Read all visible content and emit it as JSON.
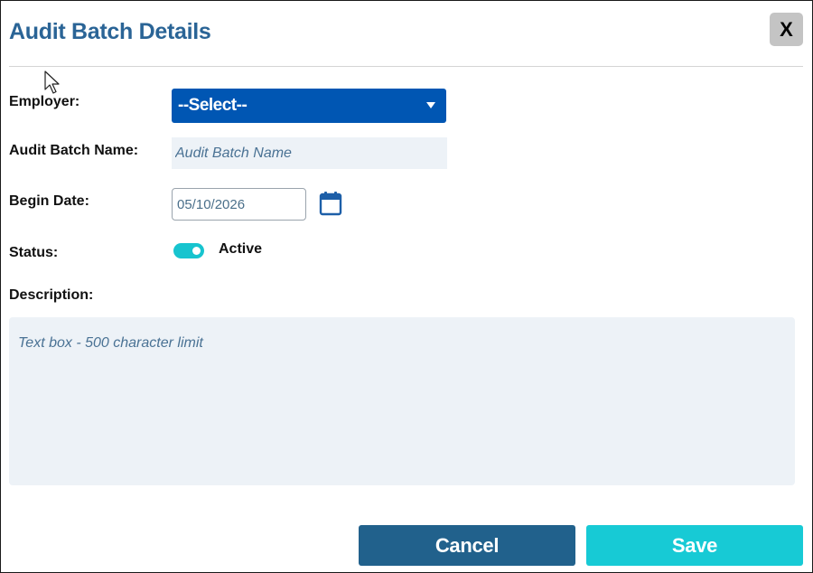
{
  "dialog": {
    "title": "Audit Batch Details",
    "close_label": "X"
  },
  "form": {
    "employer": {
      "label": "Employer:",
      "selected": "--Select--"
    },
    "batch_name": {
      "label": "Audit Batch Name:",
      "placeholder": "Audit Batch Name",
      "value": ""
    },
    "begin_date": {
      "label": "Begin Date:",
      "value": "05/10/2026"
    },
    "status": {
      "label": "Status:",
      "toggle_label": "Active",
      "on": true
    },
    "description": {
      "label": "Description:",
      "placeholder": "Text box - 500 character limit",
      "value": ""
    }
  },
  "buttons": {
    "cancel": "Cancel",
    "save": "Save"
  },
  "colors": {
    "title": "#2a6496",
    "select_bg": "#0056b3",
    "input_bg": "#edf2f7",
    "toggle_on": "#17c4cf",
    "cancel_bg": "#21618c",
    "save_bg": "#17cad5",
    "close_bg": "#c4c4c4"
  },
  "icons": {
    "calendar": "calendar-icon",
    "caret": "caret-down-icon",
    "cursor": "mouse-pointer-icon"
  }
}
